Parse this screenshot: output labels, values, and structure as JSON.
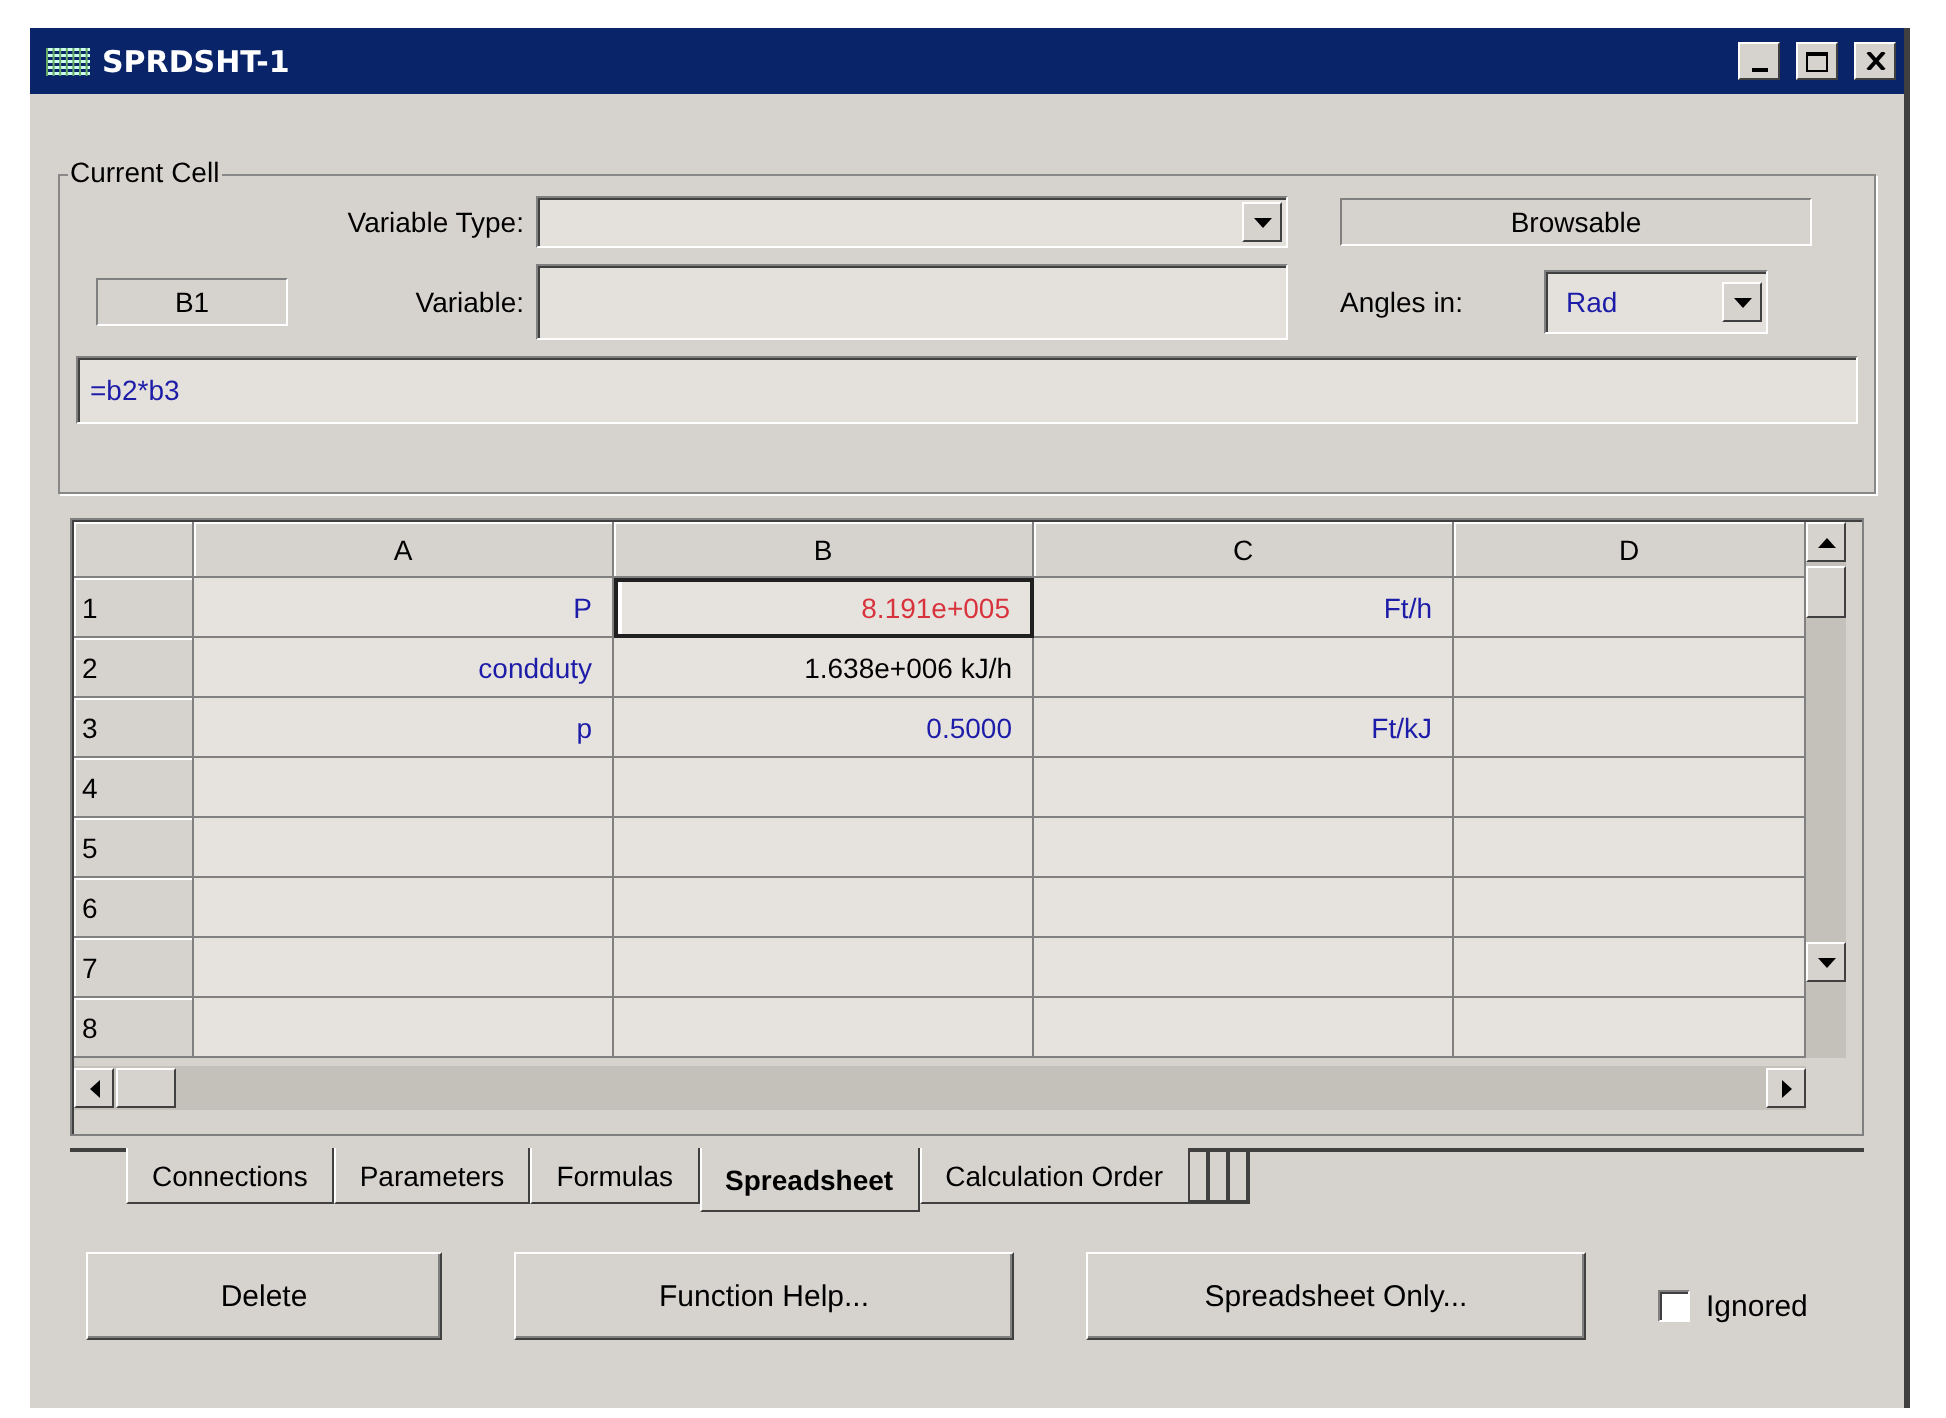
{
  "window": {
    "title": "SPRDSHT-1"
  },
  "current_cell": {
    "legend": "Current Cell",
    "variable_type_label": "Variable Type:",
    "browsable": "Browsable",
    "cell_name": "B1",
    "variable_label": "Variable:",
    "angles_label": "Angles in:",
    "angles_value": "Rad",
    "formula": "=b2*b3"
  },
  "spreadsheet": {
    "columns": [
      "A",
      "B",
      "C",
      "D"
    ],
    "rows": [
      {
        "header": "1",
        "cells": [
          {
            "text": "P",
            "color": "#1c1ca8",
            "selected": false
          },
          {
            "text": "8.191e+005",
            "color": "#d8323c",
            "selected": true
          },
          {
            "text": "Ft/h",
            "color": "#1c1ca8",
            "selected": false
          },
          {
            "selected": false
          }
        ]
      },
      {
        "header": "2",
        "cells": [
          {
            "text": "condduty",
            "color": "#1c1ca8",
            "selected": false
          },
          {
            "text": "1.638e+006 kJ/h",
            "color": "#000000",
            "selected": false
          },
          {
            "selected": false
          },
          {
            "selected": false
          }
        ]
      },
      {
        "header": "3",
        "cells": [
          {
            "text": "p",
            "color": "#1c1ca8",
            "selected": false
          },
          {
            "text": "0.5000",
            "color": "#1c1ca8",
            "selected": false
          },
          {
            "text": "Ft/kJ",
            "color": "#1c1ca8",
            "selected": false
          },
          {
            "selected": false
          }
        ]
      },
      {
        "header": "4",
        "cells": [
          {
            "selected": false
          },
          {
            "selected": false
          },
          {
            "selected": false
          },
          {
            "selected": false
          }
        ]
      },
      {
        "header": "5",
        "cells": [
          {
            "selected": false
          },
          {
            "selected": false
          },
          {
            "selected": false
          },
          {
            "selected": false
          }
        ]
      },
      {
        "header": "6",
        "cells": [
          {
            "selected": false
          },
          {
            "selected": false
          },
          {
            "selected": false
          },
          {
            "selected": false
          }
        ]
      },
      {
        "header": "7",
        "cells": [
          {
            "selected": false
          },
          {
            "selected": false
          },
          {
            "selected": false
          },
          {
            "selected": false
          }
        ]
      },
      {
        "header": "8",
        "cells": [
          {
            "selected": false
          },
          {
            "selected": false
          },
          {
            "selected": false
          },
          {
            "selected": false
          }
        ]
      }
    ]
  },
  "tabs": [
    {
      "label": "Connections",
      "selected": false
    },
    {
      "label": "Parameters",
      "selected": false
    },
    {
      "label": "Formulas",
      "selected": false
    },
    {
      "label": "Spreadsheet",
      "selected": true
    },
    {
      "label": "Calculation Order",
      "selected": false
    }
  ],
  "buttons": [
    "Delete",
    "Function Help...",
    "Spreadsheet Only..."
  ],
  "ignored": {
    "label": "Ignored",
    "checked": false
  }
}
